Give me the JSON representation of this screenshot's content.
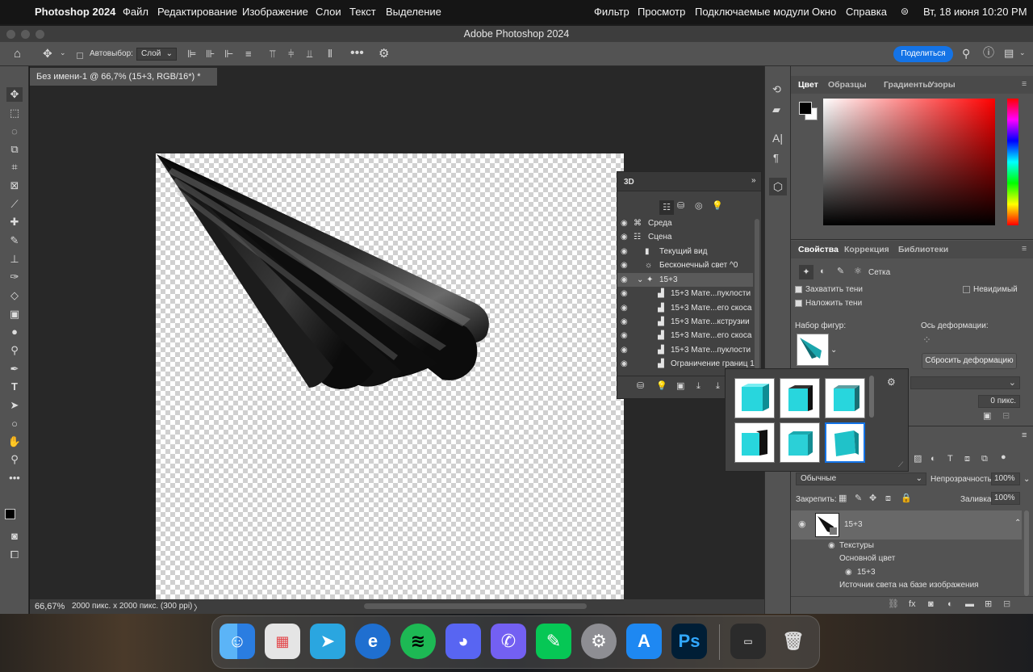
{
  "menubar": {
    "app": "Photoshop 2024",
    "items": [
      "Файл",
      "Редактирование",
      "Изображение",
      "Слои",
      "Текст",
      "Выделение",
      "Фильтр",
      "Просмотр",
      "Подключаемые модули",
      "Окно",
      "Справка"
    ],
    "clock": "Вт, 18 июня  10:20 PM"
  },
  "window": {
    "title": "Adobe Photoshop 2024"
  },
  "options": {
    "autoselect": "Автовыбор:",
    "layer": "Слой",
    "share": "Поделиться"
  },
  "document": {
    "tab": "Без имени-1 @ 66,7% (15+3, RGB/16*) *",
    "zoom": "66,67%",
    "info": "2000 пикс. x 2000 пикс. (300 ppi)"
  },
  "panel3d": {
    "title": "3D",
    "rows": [
      "Среда",
      "Сцена",
      "Текущий вид",
      "Бесконечный свет ^0",
      "15+3",
      "15+3 Мате...пуклости",
      "15+3 Мате...его скоса",
      "15+3 Мате...кструзии",
      "15+3 Мате...его скоса",
      "15+3 Мате...пуклости",
      "Ограничение границ 1"
    ]
  },
  "colorpanel": {
    "tabs": [
      "Цвет",
      "Образцы",
      "Градиенты",
      "Узоры"
    ]
  },
  "properties": {
    "tabs": [
      "Свойства",
      "Коррекция",
      "Библиотеки"
    ],
    "mesh": "Сетка",
    "cast_shadows": "Захватить тени",
    "catch_shadows": "Наложить тени",
    "invisible": "Невидимый",
    "shape_preset": "Набор фигур:",
    "deform_axis": "Ось деформации:",
    "reset_deform": "Сбросить деформацию",
    "pixels": "0 пикс."
  },
  "layers": {
    "blend": "Обычные",
    "opacity_label": "Непрозрачность:",
    "opacity": "100%",
    "lock_label": "Закрепить:",
    "fill_label": "Заливка:",
    "fill": "100%",
    "layer_name": "15+3",
    "textures": "Текстуры",
    "base_color": "Основной цвет",
    "sub": "15+3",
    "ibl": "Источник света на базе изображения"
  },
  "dock": {
    "ps": "Ps"
  },
  "colors": {
    "accent": "#1473e6",
    "cyan": "#28d6dd"
  }
}
